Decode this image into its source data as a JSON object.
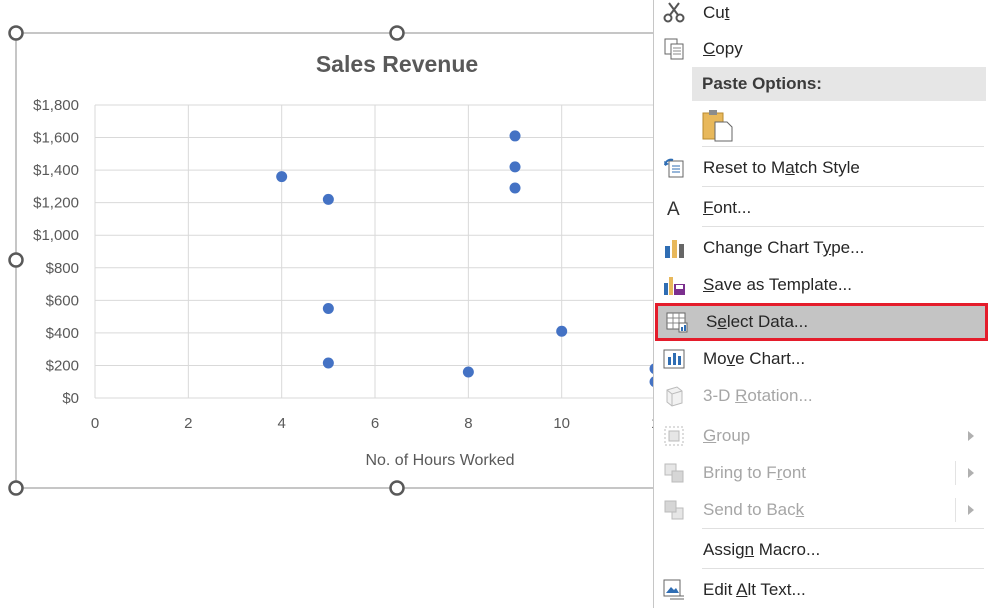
{
  "chart": {
    "title": "Sales Revenue",
    "x_axis_title": "No. of Hours Worked",
    "x_ticks": [
      "0",
      "2",
      "4",
      "6",
      "8",
      "10",
      "1"
    ],
    "y_ticks": [
      "$0",
      "$200",
      "$400",
      "$600",
      "$800",
      "$1,000",
      "$1,200",
      "$1,400",
      "$1,600",
      "$1,800"
    ],
    "point_color": "#4472c4",
    "grid": true
  },
  "chart_data": {
    "type": "scatter",
    "title": "Sales Revenue",
    "xlabel": "No. of Hours Worked",
    "ylabel": "",
    "xlim": [
      0,
      14
    ],
    "ylim": [
      0,
      1800
    ],
    "x": [
      4,
      5,
      5,
      5,
      8,
      9,
      9,
      9,
      10,
      12,
      12
    ],
    "y": [
      1360,
      1220,
      550,
      215,
      160,
      1610,
      1420,
      1290,
      410,
      180,
      100
    ]
  },
  "menu": {
    "items": [
      {
        "key": "cut",
        "pre": "Cu",
        "u": "t",
        "post": "",
        "icon": "scissors-icon",
        "disabled": false
      },
      {
        "key": "copy",
        "pre": "",
        "u": "C",
        "post": "opy",
        "icon": "copy-icon",
        "disabled": false
      },
      {
        "key": "reset",
        "pre": "Reset to M",
        "u": "a",
        "post": "tch Style",
        "icon": "reset-style-icon",
        "disabled": false
      },
      {
        "key": "font",
        "pre": "",
        "u": "F",
        "post": "ont...",
        "icon": "font-icon",
        "disabled": false
      },
      {
        "key": "change-chart-type",
        "pre": "Change Chart T",
        "u": "y",
        "post": "pe...",
        "icon": "chart-type-icon",
        "disabled": false
      },
      {
        "key": "save-template",
        "pre": "",
        "u": "S",
        "post": "ave as Template...",
        "icon": "save-template-icon",
        "disabled": false
      },
      {
        "key": "select-data",
        "pre": "S",
        "u": "e",
        "post": "lect Data...",
        "icon": "select-data-icon",
        "disabled": false
      },
      {
        "key": "move-chart",
        "pre": "Mo",
        "u": "v",
        "post": "e Chart...",
        "icon": "move-chart-icon",
        "disabled": false
      },
      {
        "key": "rotation",
        "pre": "3-D ",
        "u": "R",
        "post": "otation...",
        "icon": "rotation-icon",
        "disabled": true
      },
      {
        "key": "group",
        "pre": "",
        "u": "G",
        "post": "roup",
        "icon": "group-icon",
        "disabled": true
      },
      {
        "key": "bring-front",
        "pre": "Bring to F",
        "u": "r",
        "post": "ont",
        "icon": "bring-front-icon",
        "disabled": true
      },
      {
        "key": "send-back",
        "pre": "Send to Bac",
        "u": "k",
        "post": "",
        "icon": "send-back-icon",
        "disabled": true
      },
      {
        "key": "assign-macro",
        "pre": "Assig",
        "u": "n",
        "post": " Macro...",
        "icon": "",
        "disabled": false
      },
      {
        "key": "alt-text",
        "pre": "Edit ",
        "u": "A",
        "post": "lt Text...",
        "icon": "alt-text-icon",
        "disabled": false
      }
    ],
    "paste_options_label": "Paste Options:",
    "highlight_color": "#e41c2b"
  }
}
